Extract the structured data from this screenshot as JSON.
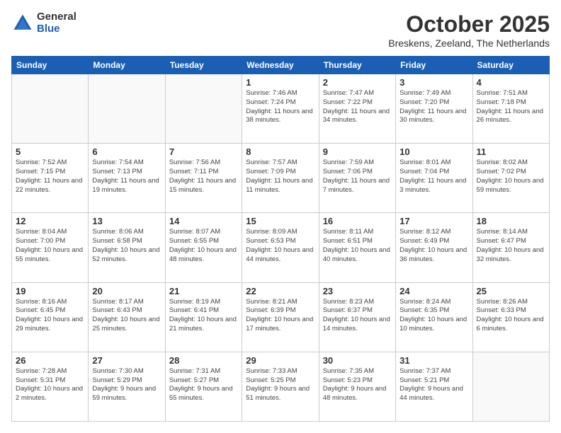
{
  "logo": {
    "general": "General",
    "blue": "Blue"
  },
  "header": {
    "month": "October 2025",
    "location": "Breskens, Zeeland, The Netherlands"
  },
  "weekdays": [
    "Sunday",
    "Monday",
    "Tuesday",
    "Wednesday",
    "Thursday",
    "Friday",
    "Saturday"
  ],
  "weeks": [
    [
      {
        "day": "",
        "info": ""
      },
      {
        "day": "",
        "info": ""
      },
      {
        "day": "",
        "info": ""
      },
      {
        "day": "1",
        "info": "Sunrise: 7:46 AM\nSunset: 7:24 PM\nDaylight: 11 hours\nand 38 minutes."
      },
      {
        "day": "2",
        "info": "Sunrise: 7:47 AM\nSunset: 7:22 PM\nDaylight: 11 hours\nand 34 minutes."
      },
      {
        "day": "3",
        "info": "Sunrise: 7:49 AM\nSunset: 7:20 PM\nDaylight: 11 hours\nand 30 minutes."
      },
      {
        "day": "4",
        "info": "Sunrise: 7:51 AM\nSunset: 7:18 PM\nDaylight: 11 hours\nand 26 minutes."
      }
    ],
    [
      {
        "day": "5",
        "info": "Sunrise: 7:52 AM\nSunset: 7:15 PM\nDaylight: 11 hours\nand 22 minutes."
      },
      {
        "day": "6",
        "info": "Sunrise: 7:54 AM\nSunset: 7:13 PM\nDaylight: 11 hours\nand 19 minutes."
      },
      {
        "day": "7",
        "info": "Sunrise: 7:56 AM\nSunset: 7:11 PM\nDaylight: 11 hours\nand 15 minutes."
      },
      {
        "day": "8",
        "info": "Sunrise: 7:57 AM\nSunset: 7:09 PM\nDaylight: 11 hours\nand 11 minutes."
      },
      {
        "day": "9",
        "info": "Sunrise: 7:59 AM\nSunset: 7:06 PM\nDaylight: 11 hours\nand 7 minutes."
      },
      {
        "day": "10",
        "info": "Sunrise: 8:01 AM\nSunset: 7:04 PM\nDaylight: 11 hours\nand 3 minutes."
      },
      {
        "day": "11",
        "info": "Sunrise: 8:02 AM\nSunset: 7:02 PM\nDaylight: 10 hours\nand 59 minutes."
      }
    ],
    [
      {
        "day": "12",
        "info": "Sunrise: 8:04 AM\nSunset: 7:00 PM\nDaylight: 10 hours\nand 55 minutes."
      },
      {
        "day": "13",
        "info": "Sunrise: 8:06 AM\nSunset: 6:58 PM\nDaylight: 10 hours\nand 52 minutes."
      },
      {
        "day": "14",
        "info": "Sunrise: 8:07 AM\nSunset: 6:55 PM\nDaylight: 10 hours\nand 48 minutes."
      },
      {
        "day": "15",
        "info": "Sunrise: 8:09 AM\nSunset: 6:53 PM\nDaylight: 10 hours\nand 44 minutes."
      },
      {
        "day": "16",
        "info": "Sunrise: 8:11 AM\nSunset: 6:51 PM\nDaylight: 10 hours\nand 40 minutes."
      },
      {
        "day": "17",
        "info": "Sunrise: 8:12 AM\nSunset: 6:49 PM\nDaylight: 10 hours\nand 36 minutes."
      },
      {
        "day": "18",
        "info": "Sunrise: 8:14 AM\nSunset: 6:47 PM\nDaylight: 10 hours\nand 32 minutes."
      }
    ],
    [
      {
        "day": "19",
        "info": "Sunrise: 8:16 AM\nSunset: 6:45 PM\nDaylight: 10 hours\nand 29 minutes."
      },
      {
        "day": "20",
        "info": "Sunrise: 8:17 AM\nSunset: 6:43 PM\nDaylight: 10 hours\nand 25 minutes."
      },
      {
        "day": "21",
        "info": "Sunrise: 8:19 AM\nSunset: 6:41 PM\nDaylight: 10 hours\nand 21 minutes."
      },
      {
        "day": "22",
        "info": "Sunrise: 8:21 AM\nSunset: 6:39 PM\nDaylight: 10 hours\nand 17 minutes."
      },
      {
        "day": "23",
        "info": "Sunrise: 8:23 AM\nSunset: 6:37 PM\nDaylight: 10 hours\nand 14 minutes."
      },
      {
        "day": "24",
        "info": "Sunrise: 8:24 AM\nSunset: 6:35 PM\nDaylight: 10 hours\nand 10 minutes."
      },
      {
        "day": "25",
        "info": "Sunrise: 8:26 AM\nSunset: 6:33 PM\nDaylight: 10 hours\nand 6 minutes."
      }
    ],
    [
      {
        "day": "26",
        "info": "Sunrise: 7:28 AM\nSunset: 5:31 PM\nDaylight: 10 hours\nand 2 minutes."
      },
      {
        "day": "27",
        "info": "Sunrise: 7:30 AM\nSunset: 5:29 PM\nDaylight: 9 hours\nand 59 minutes."
      },
      {
        "day": "28",
        "info": "Sunrise: 7:31 AM\nSunset: 5:27 PM\nDaylight: 9 hours\nand 55 minutes."
      },
      {
        "day": "29",
        "info": "Sunrise: 7:33 AM\nSunset: 5:25 PM\nDaylight: 9 hours\nand 51 minutes."
      },
      {
        "day": "30",
        "info": "Sunrise: 7:35 AM\nSunset: 5:23 PM\nDaylight: 9 hours\nand 48 minutes."
      },
      {
        "day": "31",
        "info": "Sunrise: 7:37 AM\nSunset: 5:21 PM\nDaylight: 9 hours\nand 44 minutes."
      },
      {
        "day": "",
        "info": ""
      }
    ]
  ]
}
